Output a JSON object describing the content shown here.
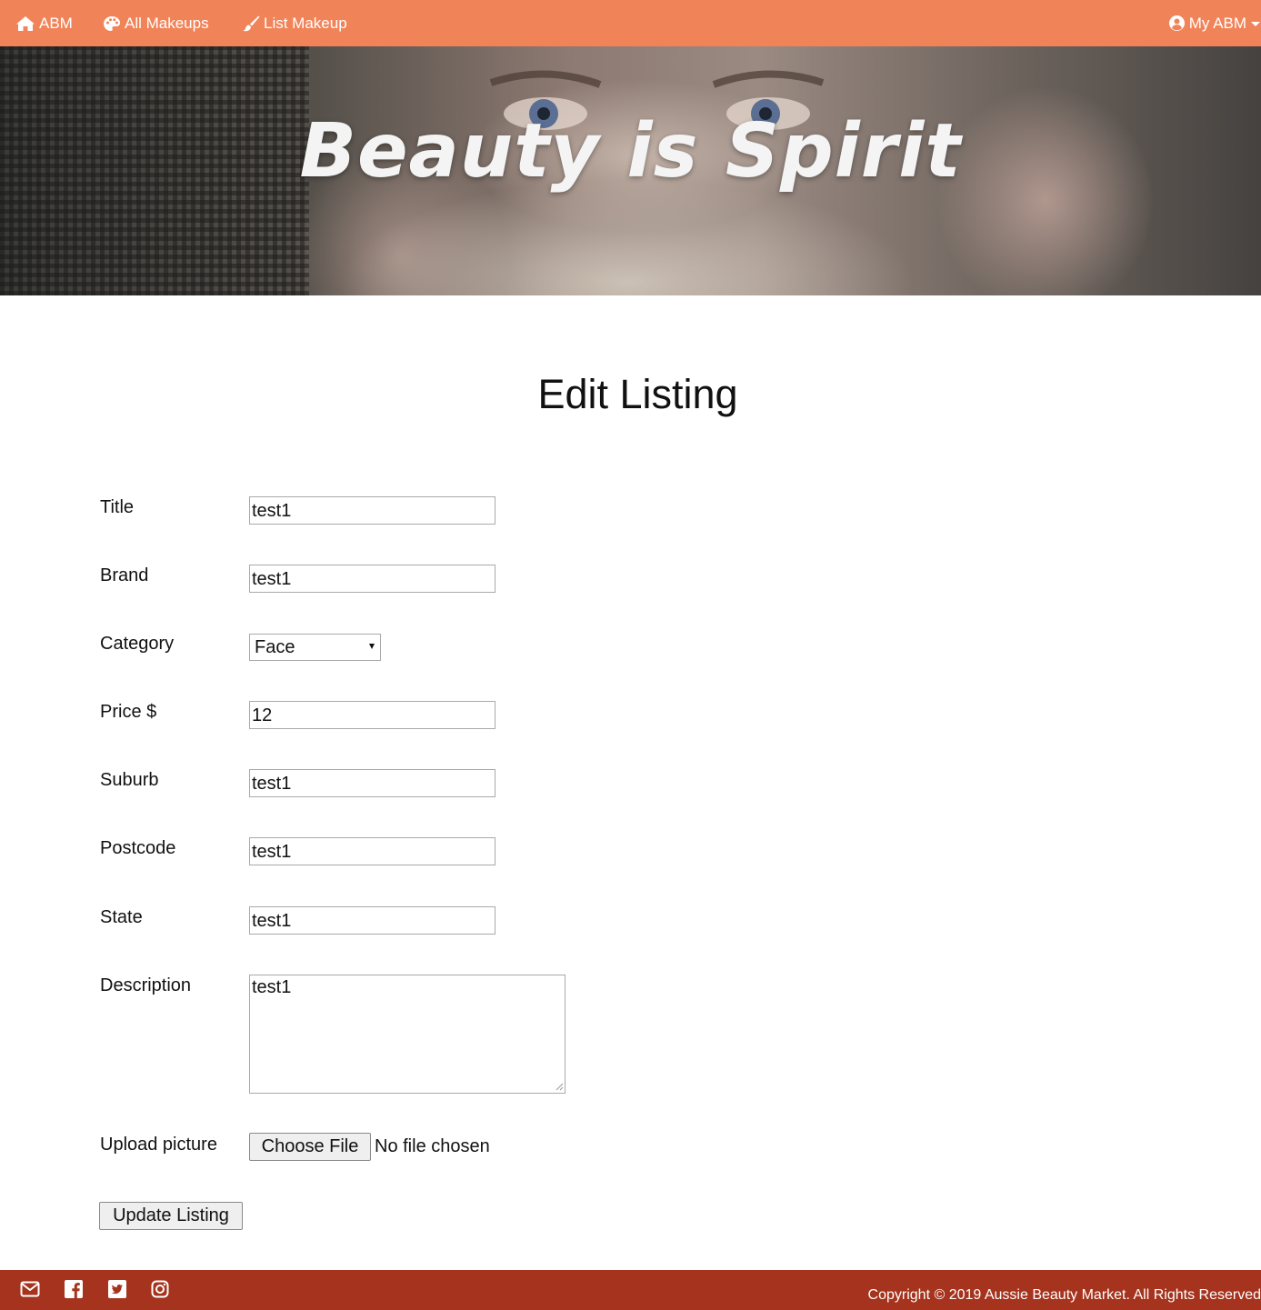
{
  "navbar": {
    "brand_label": "ABM",
    "all_makeups_label": "All Makeups",
    "list_makeup_label": "List Makeup",
    "account_label": "My ABM",
    "color": "#f18358"
  },
  "hero": {
    "slogan": "Beauty is Spirit"
  },
  "page": {
    "title": "Edit Listing"
  },
  "form": {
    "title": {
      "label": "Title",
      "value": "test1"
    },
    "brand": {
      "label": "Brand",
      "value": "test1"
    },
    "category": {
      "label": "Category",
      "value": "Face"
    },
    "price": {
      "label": "Price $",
      "value": "12"
    },
    "suburb": {
      "label": "Suburb",
      "value": "test1"
    },
    "postcode": {
      "label": "Postcode",
      "value": "test1"
    },
    "state": {
      "label": "State",
      "value": "test1"
    },
    "description": {
      "label": "Description",
      "value": "test1"
    },
    "upload": {
      "label": "Upload picture",
      "button": "Choose File",
      "status": "No file chosen"
    },
    "submit_label": "Update Listing"
  },
  "footer": {
    "color": "#a5331d",
    "icons": [
      "envelope-icon",
      "facebook-icon",
      "twitter-icon",
      "instagram-icon"
    ],
    "copyright": "Copyright © 2019 Aussie Beauty Market. All Rights Reserved"
  }
}
